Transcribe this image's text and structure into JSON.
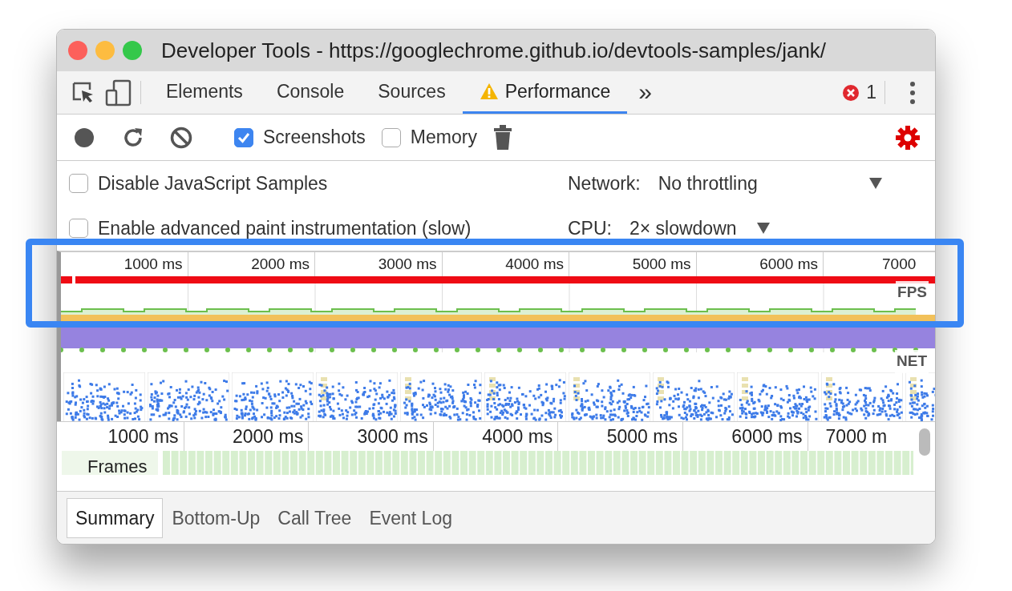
{
  "window": {
    "title": "Developer Tools - https://googlechrome.github.io/devtools-samples/jank/"
  },
  "tabs": [
    {
      "label": "Elements",
      "selected": false,
      "warning": false
    },
    {
      "label": "Console",
      "selected": false,
      "warning": false
    },
    {
      "label": "Sources",
      "selected": false,
      "warning": false
    },
    {
      "label": "Performance",
      "selected": true,
      "warning": true
    }
  ],
  "more_tabs": "»",
  "error_count": "1",
  "toolbar": {
    "options": [
      {
        "label": "Screenshots",
        "checked": true
      },
      {
        "label": "Memory",
        "checked": false
      }
    ]
  },
  "settings": {
    "options": [
      {
        "label": "Disable JavaScript Samples",
        "checked": false
      },
      {
        "label": "Enable advanced paint instrumentation (slow)",
        "checked": false
      }
    ],
    "network": {
      "label": "Network:",
      "value": "No throttling"
    },
    "cpu": {
      "label": "CPU:",
      "value": "2× slowdown"
    }
  },
  "overview": {
    "ticks": [
      "1000 ms",
      "2000 ms",
      "3000 ms",
      "4000 ms",
      "5000 ms",
      "6000 ms",
      "7000"
    ],
    "fps_label": "FPS",
    "net_label": "NET"
  },
  "timeline": {
    "ticks": [
      "1000 ms",
      "2000 ms",
      "3000 ms",
      "4000 ms",
      "5000 ms",
      "6000 ms",
      "7000 m"
    ],
    "frames_label": "Frames"
  },
  "bottom_tabs": [
    {
      "label": "Summary",
      "selected": true
    },
    {
      "label": "Bottom-Up",
      "selected": false
    },
    {
      "label": "Call Tree",
      "selected": false
    },
    {
      "label": "Event Log",
      "selected": false
    }
  ]
}
